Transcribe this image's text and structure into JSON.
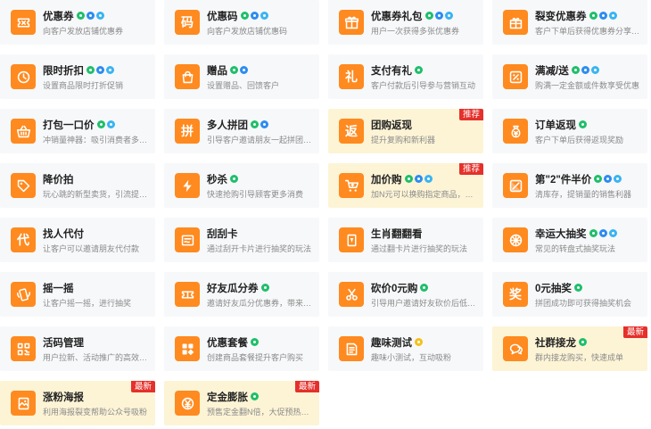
{
  "theme": {
    "accent": "#ff8a1f",
    "card_bg": "#f7f8fa",
    "highlight_bg": "#fdf4d6",
    "tag_color": "#e5302b"
  },
  "cards": [
    {
      "title": "优惠券",
      "desc": "向客户发放店铺优惠券",
      "icon": "ticket-icon",
      "badges": [
        "g",
        "bl",
        "sk"
      ]
    },
    {
      "title": "优惠码",
      "desc": "向客户发放店铺优惠码",
      "icon": "code-char-icon",
      "glyph": "码",
      "badges": [
        "g",
        "bl",
        "sk"
      ]
    },
    {
      "title": "优惠券礼包",
      "desc": "用户一次获得多张优惠券",
      "icon": "gift-pack-icon",
      "badges": [
        "g",
        "bl",
        "sk"
      ]
    },
    {
      "title": "裂变优惠券",
      "desc": "客户下单后获得优惠券分享…",
      "icon": "gift-box-icon",
      "badges": [
        "g",
        "bl",
        "sk"
      ]
    },
    {
      "title": "限时折扣",
      "desc": "设置商品限时打折促销",
      "icon": "clock-icon",
      "badges": [
        "g",
        "bl",
        "sk"
      ]
    },
    {
      "title": "赠品",
      "desc": "设置赠品、回馈客户",
      "icon": "bag-icon",
      "badges": [
        "g",
        "bl"
      ]
    },
    {
      "title": "支付有礼",
      "desc": "客户付款后引导参与营销互动",
      "icon": "gift-char-icon",
      "glyph": "礼",
      "badges": [
        "g"
      ]
    },
    {
      "title": "满减/送",
      "desc": "购满一定金额或件数享受优惠",
      "icon": "percent-icon",
      "badges": [
        "g",
        "bl",
        "sk"
      ]
    },
    {
      "title": "打包一口价",
      "desc": "冲销量神器：吸引消费者多…",
      "icon": "basket-icon",
      "badges": [
        "g",
        "sk"
      ]
    },
    {
      "title": "多人拼团",
      "desc": "引导客户邀请朋友一起拼团…",
      "icon": "group-char-icon",
      "glyph": "拼",
      "badges": [
        "g",
        "bl"
      ]
    },
    {
      "title": "团购返现",
      "desc": "提升复购和新利器",
      "icon": "return-char-icon",
      "glyph": "返",
      "badges": [],
      "highlight": true,
      "tag": "推荐"
    },
    {
      "title": "订单返现",
      "desc": "客户下单后获得返现奖励",
      "icon": "money-bag-icon",
      "badges": [
        "g"
      ]
    },
    {
      "title": "降价拍",
      "desc": "玩心跳的新型卖货，引流提…",
      "icon": "price-tag-icon",
      "badges": []
    },
    {
      "title": "秒杀",
      "desc": "快速抢购引导顾客更多消费",
      "icon": "lightning-icon",
      "badges": [
        "g"
      ]
    },
    {
      "title": "加价购",
      "desc": "加N元可以换购指定商品，提…",
      "icon": "cart-plus-icon",
      "badges": [
        "g",
        "bl",
        "sk"
      ],
      "highlight": true,
      "tag": "推荐"
    },
    {
      "title": "第\"2\"件半价",
      "desc": "清库存，提销量的销售利器",
      "icon": "half-price-icon",
      "badges": [
        "g",
        "bl",
        "sk"
      ]
    },
    {
      "title": "找人代付",
      "desc": "让客户可以邀请朋友代付款",
      "icon": "pay-char-icon",
      "glyph": "代",
      "badges": []
    },
    {
      "title": "刮刮卡",
      "desc": "通过刮开卡片进行抽奖的玩法",
      "icon": "scratch-card-icon",
      "badges": []
    },
    {
      "title": "生肖翻翻看",
      "desc": "通过翻卡片进行抽奖的玩法",
      "icon": "flip-card-icon",
      "badges": []
    },
    {
      "title": "幸运大抽奖",
      "desc": "常见的转盘式抽奖玩法",
      "icon": "wheel-icon",
      "badges": [
        "g",
        "bl",
        "sk"
      ]
    },
    {
      "title": "摇一摇",
      "desc": "让客户摇一摇，进行抽奖",
      "icon": "shake-phone-icon",
      "badges": []
    },
    {
      "title": "好友瓜分券",
      "desc": "邀请好友瓜分优惠券，带来…",
      "icon": "share-coupon-icon",
      "badges": [
        "g"
      ]
    },
    {
      "title": "砍价0元购",
      "desc": "引导用户邀请好友砍价后低…",
      "icon": "cut-price-icon",
      "badges": [
        "g"
      ]
    },
    {
      "title": "0元抽奖",
      "desc": "拼团成功即可获得抽奖机会",
      "icon": "prize-char-icon",
      "glyph": "奖",
      "badges": [
        "g"
      ]
    },
    {
      "title": "活码管理",
      "desc": "用户拉新、活动推广的高效…",
      "icon": "qr-code-icon",
      "badges": []
    },
    {
      "title": "优惠套餐",
      "desc": "创建商品套餐提升客户购买",
      "icon": "bundle-icon",
      "badges": [
        "g"
      ]
    },
    {
      "title": "趣味测试",
      "desc": "趣味小测试，互动吸粉",
      "icon": "quiz-icon",
      "badges": [
        "y"
      ]
    },
    {
      "title": "社群接龙",
      "desc": "群内接龙购买，快速成单",
      "icon": "chat-icon",
      "badges": [
        "g"
      ],
      "highlight": true,
      "tag": "最新"
    },
    {
      "title": "涨粉海报",
      "desc": "利用海报裂变帮助公众号吸粉",
      "icon": "poster-icon",
      "badges": [],
      "highlight": true,
      "tag": "最新"
    },
    {
      "title": "定金膨胀",
      "desc": "预售定金翻N倍，大促预热利器",
      "icon": "deposit-icon",
      "badges": [
        "g"
      ],
      "highlight": true,
      "tag": "最新"
    }
  ]
}
